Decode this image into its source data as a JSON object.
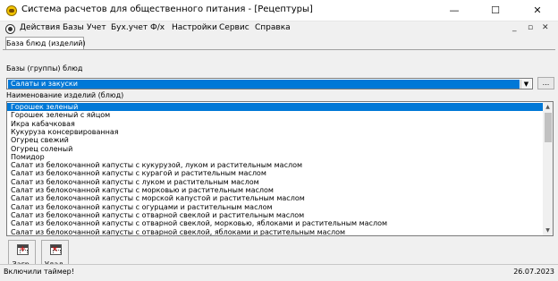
{
  "window": {
    "title": "Система расчетов для общественного питания - [Рецептуры]",
    "minimize_glyph": "—",
    "maximize_glyph": "☐",
    "close_glyph": "✕"
  },
  "menu": {
    "items": [
      "Действия",
      "Базы",
      "Учет",
      "Бух.учет",
      "Ф/х",
      "Настройки",
      "Сервис",
      "Справка"
    ],
    "mdi_minimize": "_",
    "mdi_restore": "▫",
    "mdi_close": "✕"
  },
  "tab": {
    "label": "База блюд (изделий)"
  },
  "groups": {
    "label": "Базы (группы) блюд",
    "selected": "Салаты и закуски",
    "browse_label": "..."
  },
  "items": {
    "label": "Наименование изделий (блюд)",
    "selected_index": 0,
    "list": [
      "Горошек зеленый",
      "Горошек зеленый с яйцом",
      "Икра кабачковая",
      "Кукуруза консервированная",
      "Огурец свежий",
      "Огурец соленый",
      "Помидор",
      "Салат из белокочанной капусты с кукурузой, луком и растительным маслом",
      "Салат из белокочанной капусты с курагой и растительным маслом",
      "Салат из белокочанной капусты с луком и растительным маслом",
      "Салат из белокочанной капусты с морковью и растительным маслом",
      "Салат из белокочанной капусты с морской капустой и растительным маслом",
      "Салат из белокочанной капусты с огурцами и растительным маслом",
      "Салат из белокочанной капусты с отварной свеклой и растительным маслом",
      "Салат из белокочанной капусты с отварной свеклой, морковью, яблоками и растительным маслом",
      "Салат из белокочанной капусты с отварной свеклой, яблоками и растительным маслом"
    ]
  },
  "toolbar": {
    "load_label": "Загр.",
    "delete_label": "Удал."
  },
  "status": {
    "message": "Включили таймер!",
    "date": "26.07.2023"
  },
  "colors": {
    "selection": "#0078d7",
    "window_bg": "#f0f0f0"
  }
}
